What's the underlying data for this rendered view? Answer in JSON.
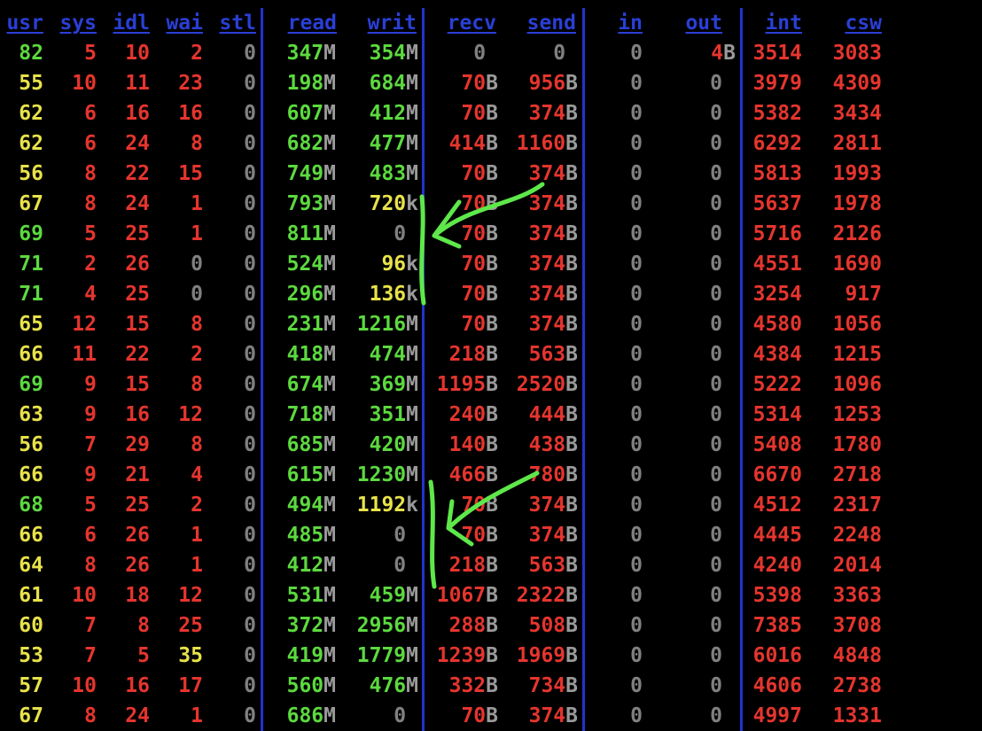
{
  "top_line_fragment": "",
  "colors": {
    "background": "#000000",
    "header": "#2a3fd6",
    "separator": "#2233cc",
    "green": "#5cd93f",
    "yellow": "#e8e24a",
    "red": "#e5352e",
    "gray": "#808080",
    "annotation": "#5ee84a"
  },
  "headers": [
    "usr",
    "sys",
    "idl",
    "wai",
    "stl",
    "read",
    "writ",
    "recv",
    "send",
    "in",
    "out",
    "int",
    "csw"
  ],
  "rows": [
    [
      [
        "82",
        "g"
      ],
      [
        "5",
        "r"
      ],
      [
        "10",
        "r"
      ],
      [
        "2",
        "r"
      ],
      [
        "0",
        "d"
      ],
      [
        "347",
        "g",
        "M"
      ],
      [
        "354",
        "g",
        "M"
      ],
      [
        "0",
        "d",
        ""
      ],
      [
        "0",
        "d",
        ""
      ],
      [
        "0",
        "d"
      ],
      [
        "4",
        "r",
        "B"
      ],
      [
        "3514",
        "r"
      ],
      [
        "3083",
        "r"
      ]
    ],
    [
      [
        "55",
        "y"
      ],
      [
        "10",
        "r"
      ],
      [
        "11",
        "r"
      ],
      [
        "23",
        "r"
      ],
      [
        "0",
        "d"
      ],
      [
        "198",
        "g",
        "M"
      ],
      [
        "684",
        "g",
        "M"
      ],
      [
        "70",
        "r",
        "B"
      ],
      [
        "956",
        "r",
        "B"
      ],
      [
        "0",
        "d"
      ],
      [
        "0",
        "d"
      ],
      [
        "3979",
        "r"
      ],
      [
        "4309",
        "r"
      ]
    ],
    [
      [
        "62",
        "y"
      ],
      [
        "6",
        "r"
      ],
      [
        "16",
        "r"
      ],
      [
        "16",
        "r"
      ],
      [
        "0",
        "d"
      ],
      [
        "607",
        "g",
        "M"
      ],
      [
        "412",
        "g",
        "M"
      ],
      [
        "70",
        "r",
        "B"
      ],
      [
        "374",
        "r",
        "B"
      ],
      [
        "0",
        "d"
      ],
      [
        "0",
        "d"
      ],
      [
        "5382",
        "r"
      ],
      [
        "3434",
        "r"
      ]
    ],
    [
      [
        "62",
        "y"
      ],
      [
        "6",
        "r"
      ],
      [
        "24",
        "r"
      ],
      [
        "8",
        "r"
      ],
      [
        "0",
        "d"
      ],
      [
        "682",
        "g",
        "M"
      ],
      [
        "477",
        "g",
        "M"
      ],
      [
        "414",
        "r",
        "B"
      ],
      [
        "1160",
        "r",
        "B"
      ],
      [
        "0",
        "d"
      ],
      [
        "0",
        "d"
      ],
      [
        "6292",
        "r"
      ],
      [
        "2811",
        "r"
      ]
    ],
    [
      [
        "56",
        "y"
      ],
      [
        "8",
        "r"
      ],
      [
        "22",
        "r"
      ],
      [
        "15",
        "r"
      ],
      [
        "0",
        "d"
      ],
      [
        "749",
        "g",
        "M"
      ],
      [
        "483",
        "g",
        "M"
      ],
      [
        "70",
        "r",
        "B"
      ],
      [
        "374",
        "r",
        "B"
      ],
      [
        "0",
        "d"
      ],
      [
        "0",
        "d"
      ],
      [
        "5813",
        "r"
      ],
      [
        "1993",
        "r"
      ]
    ],
    [
      [
        "67",
        "y"
      ],
      [
        "8",
        "r"
      ],
      [
        "24",
        "r"
      ],
      [
        "1",
        "r"
      ],
      [
        "0",
        "d"
      ],
      [
        "793",
        "g",
        "M"
      ],
      [
        "720",
        "y",
        "k"
      ],
      [
        "70",
        "r",
        "B"
      ],
      [
        "374",
        "r",
        "B"
      ],
      [
        "0",
        "d"
      ],
      [
        "0",
        "d"
      ],
      [
        "5637",
        "r"
      ],
      [
        "1978",
        "r"
      ]
    ],
    [
      [
        "69",
        "g"
      ],
      [
        "5",
        "r"
      ],
      [
        "25",
        "r"
      ],
      [
        "1",
        "r"
      ],
      [
        "0",
        "d"
      ],
      [
        "811",
        "g",
        "M"
      ],
      [
        "0",
        "d",
        ""
      ],
      [
        "70",
        "r",
        "B"
      ],
      [
        "374",
        "r",
        "B"
      ],
      [
        "0",
        "d"
      ],
      [
        "0",
        "d"
      ],
      [
        "5716",
        "r"
      ],
      [
        "2126",
        "r"
      ]
    ],
    [
      [
        "71",
        "g"
      ],
      [
        "2",
        "r"
      ],
      [
        "26",
        "r"
      ],
      [
        "0",
        "d"
      ],
      [
        "0",
        "d"
      ],
      [
        "524",
        "g",
        "M"
      ],
      [
        "96",
        "y",
        "k"
      ],
      [
        "70",
        "r",
        "B"
      ],
      [
        "374",
        "r",
        "B"
      ],
      [
        "0",
        "d"
      ],
      [
        "0",
        "d"
      ],
      [
        "4551",
        "r"
      ],
      [
        "1690",
        "r"
      ]
    ],
    [
      [
        "71",
        "g"
      ],
      [
        "4",
        "r"
      ],
      [
        "25",
        "r"
      ],
      [
        "0",
        "d"
      ],
      [
        "0",
        "d"
      ],
      [
        "296",
        "g",
        "M"
      ],
      [
        "136",
        "y",
        "k"
      ],
      [
        "70",
        "r",
        "B"
      ],
      [
        "374",
        "r",
        "B"
      ],
      [
        "0",
        "d"
      ],
      [
        "0",
        "d"
      ],
      [
        "3254",
        "r"
      ],
      [
        "917",
        "r"
      ]
    ],
    [
      [
        "65",
        "y"
      ],
      [
        "12",
        "r"
      ],
      [
        "15",
        "r"
      ],
      [
        "8",
        "r"
      ],
      [
        "0",
        "d"
      ],
      [
        "231",
        "g",
        "M"
      ],
      [
        "1216",
        "g",
        "M"
      ],
      [
        "70",
        "r",
        "B"
      ],
      [
        "374",
        "r",
        "B"
      ],
      [
        "0",
        "d"
      ],
      [
        "0",
        "d"
      ],
      [
        "4580",
        "r"
      ],
      [
        "1056",
        "r"
      ]
    ],
    [
      [
        "66",
        "y"
      ],
      [
        "11",
        "r"
      ],
      [
        "22",
        "r"
      ],
      [
        "2",
        "r"
      ],
      [
        "0",
        "d"
      ],
      [
        "418",
        "g",
        "M"
      ],
      [
        "474",
        "g",
        "M"
      ],
      [
        "218",
        "r",
        "B"
      ],
      [
        "563",
        "r",
        "B"
      ],
      [
        "0",
        "d"
      ],
      [
        "0",
        "d"
      ],
      [
        "4384",
        "r"
      ],
      [
        "1215",
        "r"
      ]
    ],
    [
      [
        "69",
        "g"
      ],
      [
        "9",
        "r"
      ],
      [
        "15",
        "r"
      ],
      [
        "8",
        "r"
      ],
      [
        "0",
        "d"
      ],
      [
        "674",
        "g",
        "M"
      ],
      [
        "369",
        "g",
        "M"
      ],
      [
        "1195",
        "r",
        "B"
      ],
      [
        "2520",
        "r",
        "B"
      ],
      [
        "0",
        "d"
      ],
      [
        "0",
        "d"
      ],
      [
        "5222",
        "r"
      ],
      [
        "1096",
        "r"
      ]
    ],
    [
      [
        "63",
        "y"
      ],
      [
        "9",
        "r"
      ],
      [
        "16",
        "r"
      ],
      [
        "12",
        "r"
      ],
      [
        "0",
        "d"
      ],
      [
        "718",
        "g",
        "M"
      ],
      [
        "351",
        "g",
        "M"
      ],
      [
        "240",
        "r",
        "B"
      ],
      [
        "444",
        "r",
        "B"
      ],
      [
        "0",
        "d"
      ],
      [
        "0",
        "d"
      ],
      [
        "5314",
        "r"
      ],
      [
        "1253",
        "r"
      ]
    ],
    [
      [
        "56",
        "y"
      ],
      [
        "7",
        "r"
      ],
      [
        "29",
        "r"
      ],
      [
        "8",
        "r"
      ],
      [
        "0",
        "d"
      ],
      [
        "685",
        "g",
        "M"
      ],
      [
        "420",
        "g",
        "M"
      ],
      [
        "140",
        "r",
        "B"
      ],
      [
        "438",
        "r",
        "B"
      ],
      [
        "0",
        "d"
      ],
      [
        "0",
        "d"
      ],
      [
        "5408",
        "r"
      ],
      [
        "1780",
        "r"
      ]
    ],
    [
      [
        "66",
        "y"
      ],
      [
        "9",
        "r"
      ],
      [
        "21",
        "r"
      ],
      [
        "4",
        "r"
      ],
      [
        "0",
        "d"
      ],
      [
        "615",
        "g",
        "M"
      ],
      [
        "1230",
        "g",
        "M"
      ],
      [
        "466",
        "r",
        "B"
      ],
      [
        "780",
        "r",
        "B"
      ],
      [
        "0",
        "d"
      ],
      [
        "0",
        "d"
      ],
      [
        "6670",
        "r"
      ],
      [
        "2718",
        "r"
      ]
    ],
    [
      [
        "68",
        "g"
      ],
      [
        "5",
        "r"
      ],
      [
        "25",
        "r"
      ],
      [
        "2",
        "r"
      ],
      [
        "0",
        "d"
      ],
      [
        "494",
        "g",
        "M"
      ],
      [
        "1192",
        "y",
        "k"
      ],
      [
        "70",
        "r",
        "B"
      ],
      [
        "374",
        "r",
        "B"
      ],
      [
        "0",
        "d"
      ],
      [
        "0",
        "d"
      ],
      [
        "4512",
        "r"
      ],
      [
        "2317",
        "r"
      ]
    ],
    [
      [
        "66",
        "y"
      ],
      [
        "6",
        "r"
      ],
      [
        "26",
        "r"
      ],
      [
        "1",
        "r"
      ],
      [
        "0",
        "d"
      ],
      [
        "485",
        "g",
        "M"
      ],
      [
        "0",
        "d",
        ""
      ],
      [
        "70",
        "r",
        "B"
      ],
      [
        "374",
        "r",
        "B"
      ],
      [
        "0",
        "d"
      ],
      [
        "0",
        "d"
      ],
      [
        "4445",
        "r"
      ],
      [
        "2248",
        "r"
      ]
    ],
    [
      [
        "64",
        "y"
      ],
      [
        "8",
        "r"
      ],
      [
        "26",
        "r"
      ],
      [
        "1",
        "r"
      ],
      [
        "0",
        "d"
      ],
      [
        "412",
        "g",
        "M"
      ],
      [
        "0",
        "d",
        ""
      ],
      [
        "218",
        "r",
        "B"
      ],
      [
        "563",
        "r",
        "B"
      ],
      [
        "0",
        "d"
      ],
      [
        "0",
        "d"
      ],
      [
        "4240",
        "r"
      ],
      [
        "2014",
        "r"
      ]
    ],
    [
      [
        "61",
        "y"
      ],
      [
        "10",
        "r"
      ],
      [
        "18",
        "r"
      ],
      [
        "12",
        "r"
      ],
      [
        "0",
        "d"
      ],
      [
        "531",
        "g",
        "M"
      ],
      [
        "459",
        "g",
        "M"
      ],
      [
        "1067",
        "r",
        "B"
      ],
      [
        "2322",
        "r",
        "B"
      ],
      [
        "0",
        "d"
      ],
      [
        "0",
        "d"
      ],
      [
        "5398",
        "r"
      ],
      [
        "3363",
        "r"
      ]
    ],
    [
      [
        "60",
        "y"
      ],
      [
        "7",
        "r"
      ],
      [
        "8",
        "r"
      ],
      [
        "25",
        "r"
      ],
      [
        "0",
        "d"
      ],
      [
        "372",
        "g",
        "M"
      ],
      [
        "2956",
        "g",
        "M"
      ],
      [
        "288",
        "r",
        "B"
      ],
      [
        "508",
        "r",
        "B"
      ],
      [
        "0",
        "d"
      ],
      [
        "0",
        "d"
      ],
      [
        "7385",
        "r"
      ],
      [
        "3708",
        "r"
      ]
    ],
    [
      [
        "53",
        "y"
      ],
      [
        "7",
        "r"
      ],
      [
        "5",
        "r"
      ],
      [
        "35",
        "y"
      ],
      [
        "0",
        "d"
      ],
      [
        "419",
        "g",
        "M"
      ],
      [
        "1779",
        "g",
        "M"
      ],
      [
        "1239",
        "r",
        "B"
      ],
      [
        "1969",
        "r",
        "B"
      ],
      [
        "0",
        "d"
      ],
      [
        "0",
        "d"
      ],
      [
        "6016",
        "r"
      ],
      [
        "4848",
        "r"
      ]
    ],
    [
      [
        "57",
        "y"
      ],
      [
        "10",
        "r"
      ],
      [
        "16",
        "r"
      ],
      [
        "17",
        "r"
      ],
      [
        "0",
        "d"
      ],
      [
        "560",
        "g",
        "M"
      ],
      [
        "476",
        "g",
        "M"
      ],
      [
        "332",
        "r",
        "B"
      ],
      [
        "734",
        "r",
        "B"
      ],
      [
        "0",
        "d"
      ],
      [
        "0",
        "d"
      ],
      [
        "4606",
        "r"
      ],
      [
        "2738",
        "r"
      ]
    ],
    [
      [
        "67",
        "y"
      ],
      [
        "8",
        "r"
      ],
      [
        "24",
        "r"
      ],
      [
        "1",
        "r"
      ],
      [
        "0",
        "d"
      ],
      [
        "686",
        "g",
        "M"
      ],
      [
        "0",
        "d",
        ""
      ],
      [
        "70",
        "r",
        "B"
      ],
      [
        "374",
        "r",
        "B"
      ],
      [
        "0",
        "d"
      ],
      [
        "0",
        "d"
      ],
      [
        "4997",
        "r"
      ],
      [
        "1331",
        "r"
      ]
    ]
  ]
}
